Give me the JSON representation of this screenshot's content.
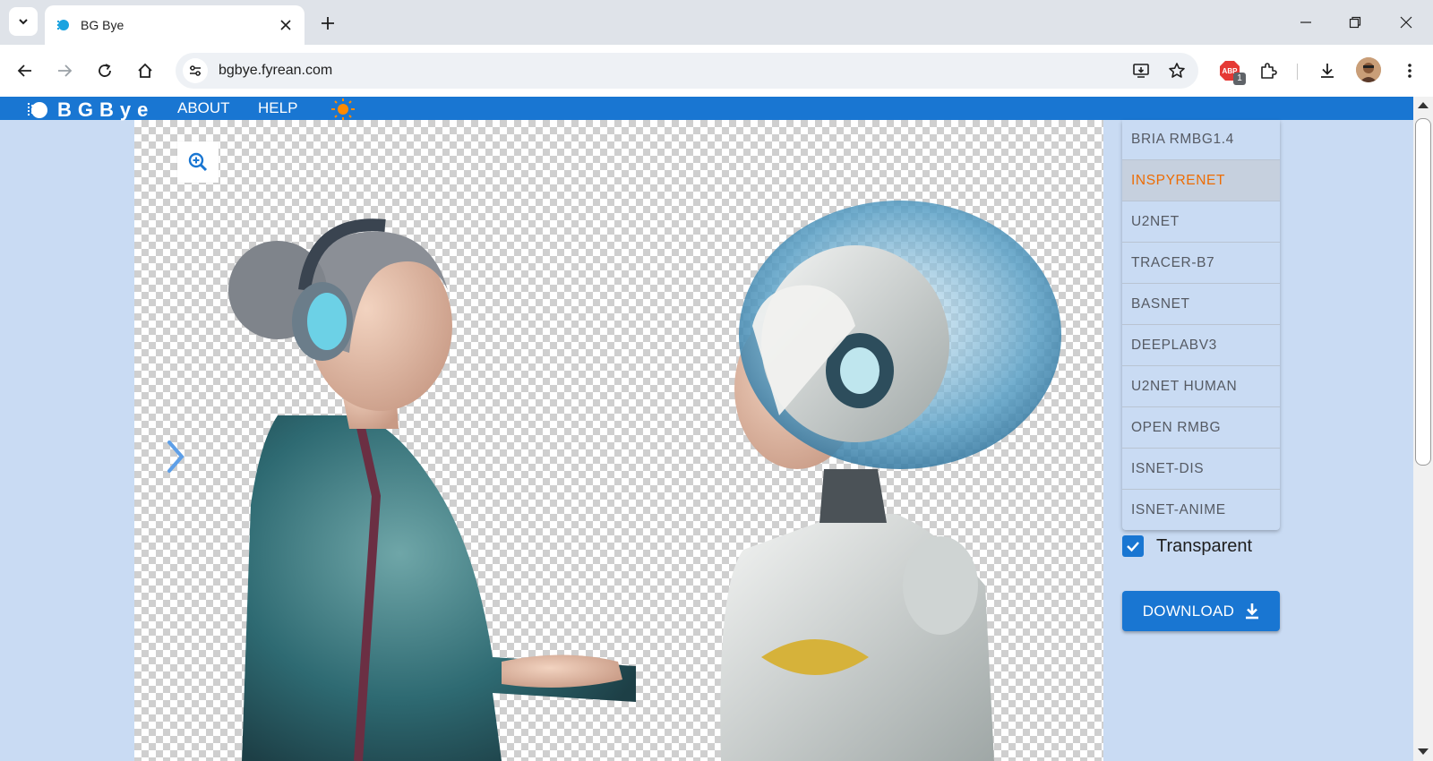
{
  "browser": {
    "tab_title": "BG Bye",
    "url": "bgbye.fyrean.com",
    "extension_badge": "1",
    "icons": [
      "tab-search-icon",
      "favicon-icon",
      "close-icon",
      "plus-icon",
      "minimize-icon",
      "restore-icon",
      "back-icon",
      "forward-icon",
      "reload-icon",
      "home-icon",
      "site-settings-icon",
      "install-app-icon",
      "star-icon",
      "adblock-icon",
      "puzzle-icon",
      "download-icon",
      "kebab-menu-icon"
    ]
  },
  "app": {
    "logo_text": "BGBye",
    "nav": {
      "about": "ABOUT",
      "help": "HELP"
    },
    "theme_icon": "sun-icon",
    "accent_color": "#1976d2",
    "selected_color": "#ed6c02"
  },
  "models": [
    {
      "label": "BRIA RMBG1.4",
      "selected": false
    },
    {
      "label": "INSPYRENET",
      "selected": true
    },
    {
      "label": "U2NET",
      "selected": false
    },
    {
      "label": "TRACER-B7",
      "selected": false
    },
    {
      "label": "BASNET",
      "selected": false
    },
    {
      "label": "DEEPLABV3",
      "selected": false
    },
    {
      "label": "U2NET HUMAN",
      "selected": false
    },
    {
      "label": "OPEN RMBG",
      "selected": false
    },
    {
      "label": "ISNET-DIS",
      "selected": false
    },
    {
      "label": "ISNET-ANIME",
      "selected": false
    }
  ],
  "options": {
    "transparent_label": "Transparent",
    "transparent_checked": true
  },
  "actions": {
    "download_label": "DOWNLOAD"
  }
}
